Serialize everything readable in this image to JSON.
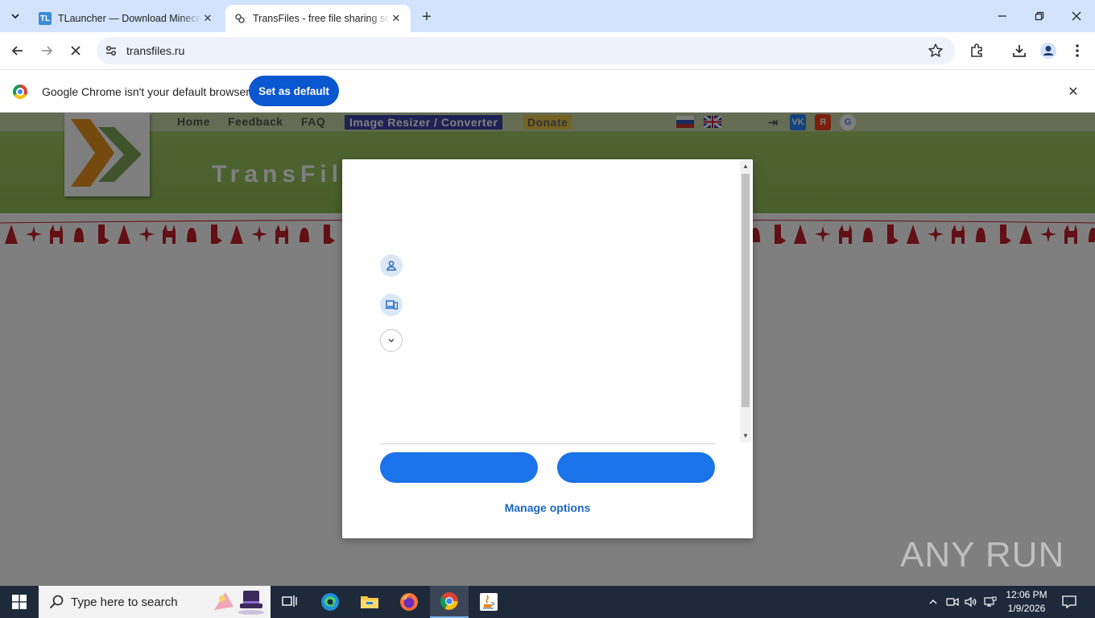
{
  "browser": {
    "tabs": [
      {
        "title": "TLauncher — Download Minecraft",
        "favicon": "TL",
        "active": false
      },
      {
        "title": "TransFiles - free file sharing service",
        "active": true
      }
    ],
    "address": "transfiles.ru",
    "infobar": {
      "message": "Google Chrome isn't your default browser",
      "button": "Set as default"
    }
  },
  "site": {
    "menu": [
      "Home",
      "Feedback",
      "FAQ",
      "Image Resizer / Converter",
      "Donate"
    ],
    "title": "TransFile",
    "social": [
      "VK",
      "Я",
      "G"
    ]
  },
  "dialog": {
    "manage_options": "Manage options"
  },
  "watermark": "ANY RUN",
  "taskbar": {
    "search_placeholder": "Type here to search",
    "time": "12:06 PM",
    "date": "1/9/2026"
  },
  "colors": {
    "tabstrip": "#d3e3fd",
    "primary_button": "#0b57d0",
    "dialog_button": "#1a73e8",
    "link": "#1a66c4",
    "taskbar": "#1e2a3a"
  }
}
